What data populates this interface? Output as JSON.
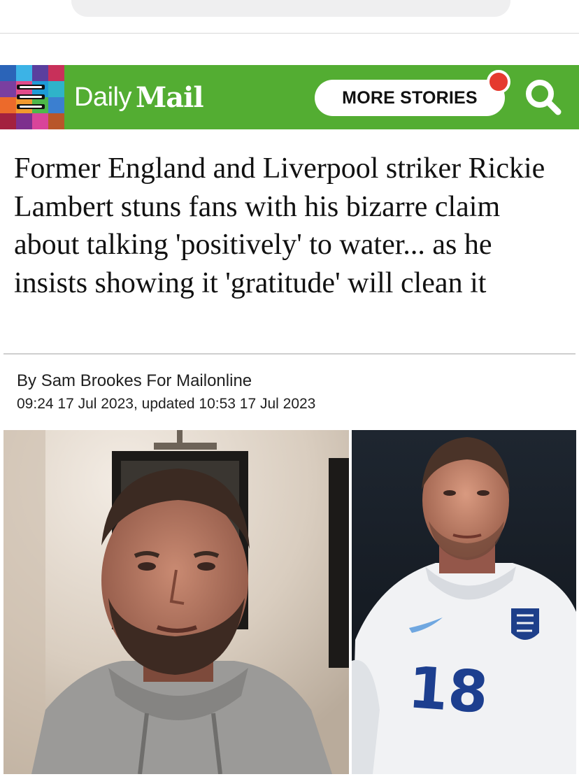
{
  "masthead": {
    "logo_daily": "Daily",
    "logo_mail": "Mail",
    "more_stories_label": "MORE STORIES",
    "brand_green": "#53ad32",
    "notification_color": "#e53a2f",
    "menu_icon": "hamburger-menu-icon",
    "search_icon": "search-icon"
  },
  "article": {
    "headline": "Former England and Liverpool striker Rickie Lambert stuns fans with his bizarre claim about talking 'positively' to water... as he insists showing it 'gratitude' will clean it",
    "byline_prefix": "By ",
    "author": "Sam Brookes For Mailonline",
    "dateline": "09:24 17 Jul 2023, updated 10:53 17 Jul 2023"
  },
  "images": {
    "shirt_number": "18"
  }
}
